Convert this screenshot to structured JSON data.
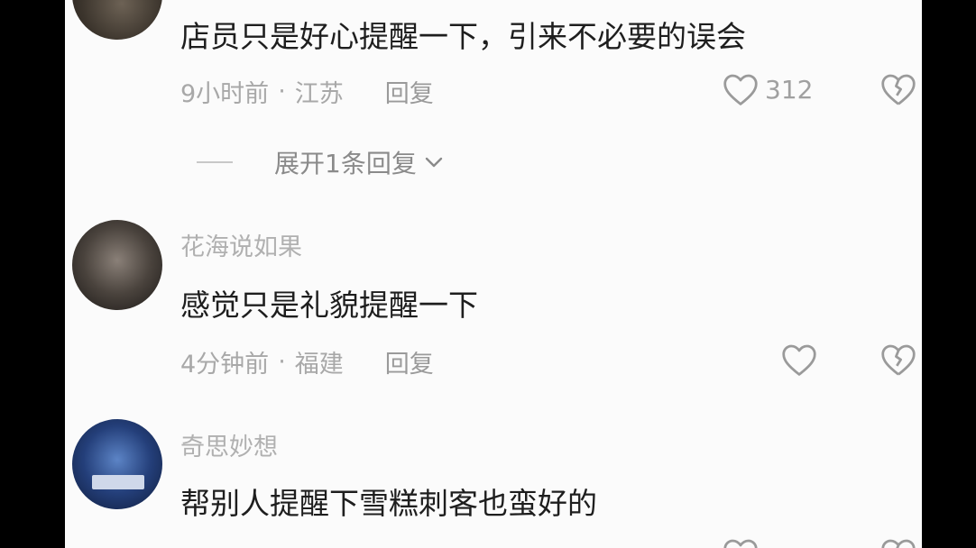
{
  "comments": [
    {
      "username": "",
      "text": "店员只是好心提醒一下，引来不必要的误会",
      "time": "9小时前",
      "separator": "·",
      "location": "江苏",
      "reply_label": "回复",
      "likes": "312",
      "expand_label": "展开1条回复"
    },
    {
      "username": "花海说如果",
      "text": "感觉只是礼貌提醒一下",
      "time": "4分钟前",
      "separator": "·",
      "location": "福建",
      "reply_label": "回复",
      "likes": ""
    },
    {
      "username": "奇思妙想",
      "text": "帮别人提醒下雪糕刺客也蛮好的"
    }
  ],
  "colors": {
    "background": "#fbfbfb",
    "text": "#1e1e1e",
    "muted": "#a8a8a8"
  },
  "icons": [
    "heart-icon",
    "broken-heart-icon",
    "chevron-down-icon"
  ]
}
